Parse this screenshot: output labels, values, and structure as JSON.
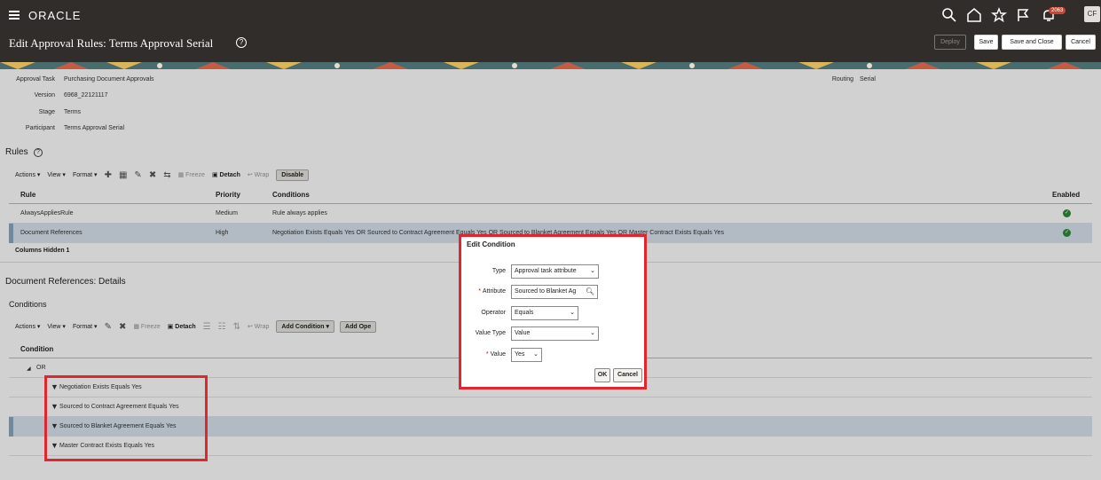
{
  "topbar": {
    "logo": "ORACLE",
    "notifications": "2063",
    "avatar": "CF"
  },
  "page": {
    "title": "Edit Approval Rules: Terms Approval Serial",
    "help": "?"
  },
  "actions": {
    "deploy": "Deploy",
    "save": "Save",
    "save_close": "Save and Close",
    "cancel": "Cancel"
  },
  "info": {
    "approval_task_label": "Approval Task",
    "approval_task": "Purchasing Document Approvals",
    "version_label": "Version",
    "version": "6968_22121117",
    "stage_label": "Stage",
    "stage": "Terms",
    "participant_label": "Participant",
    "participant": "Terms Approval Serial",
    "routing_label": "Routing",
    "routing": "Serial"
  },
  "rules": {
    "heading": "Rules",
    "toolbar": {
      "actions": "Actions ▾",
      "view": "View ▾",
      "format": "Format ▾",
      "freeze": "Freeze",
      "detach": "Detach",
      "wrap": "Wrap",
      "disable": "Disable"
    },
    "columns": {
      "rule": "Rule",
      "priority": "Priority",
      "conditions": "Conditions",
      "enabled": "Enabled"
    },
    "rows": [
      {
        "rule": "AlwaysAppliesRule",
        "priority": "Medium",
        "conditions": "Rule always applies"
      },
      {
        "rule": "Document References",
        "priority": "High",
        "conditions": "Negotiation Exists Equals Yes OR Sourced to Contract Agreement Equals Yes OR Sourced to Blanket Agreement Equals Yes OR Master Contract Exists Equals Yes"
      }
    ],
    "columns_hidden": "Columns Hidden  1"
  },
  "details": {
    "heading": "Document References: Details",
    "conditions_label": "Conditions",
    "toolbar": {
      "actions": "Actions ▾",
      "view": "View ▾",
      "format": "Format ▾",
      "freeze": "Freeze",
      "detach": "Detach",
      "wrap": "Wrap",
      "add_condition": "Add Condition ▾",
      "add_operator": "Add Ope"
    },
    "column": "Condition",
    "operator": "OR",
    "conditions": [
      "Negotiation Exists Equals Yes",
      "Sourced to Contract Agreement Equals Yes",
      "Sourced to Blanket Agreement Equals Yes",
      "Master Contract Exists Equals Yes"
    ]
  },
  "dialog": {
    "title": "Edit Condition",
    "type_label": "Type",
    "type_value": "Approval task attribute",
    "attribute_label": "Attribute",
    "attribute_value": "Sourced to Blanket Ag",
    "operator_label": "Operator",
    "operator_value": "Equals",
    "value_type_label": "Value Type",
    "value_type_value": "Value",
    "value_label": "Value",
    "value_value": "Yes",
    "required": "*",
    "ok": "OK",
    "cancel": "Cancel"
  },
  "colors": {
    "header": "#312d2a",
    "highlight": "#e0262e",
    "selected_row": "#d9e5f0",
    "check": "#2e8b3a"
  }
}
